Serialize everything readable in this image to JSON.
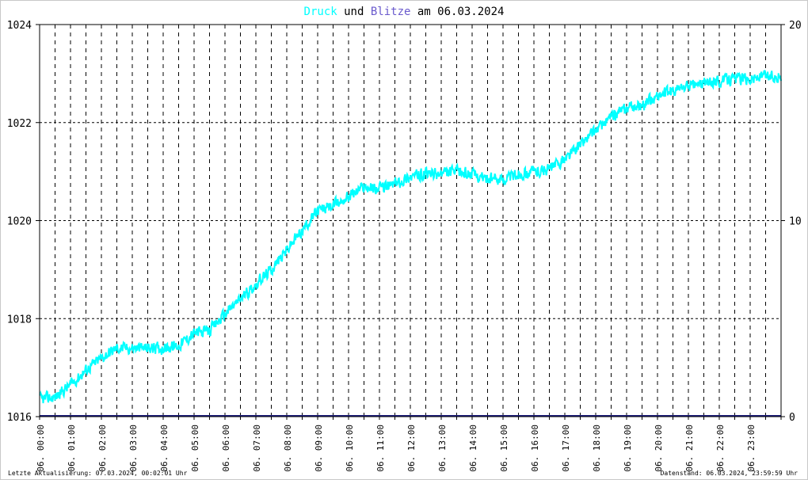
{
  "title": {
    "part1": "Druck",
    "part2": " und ",
    "part3": "Blitze",
    "part4": " am 06.03.2024"
  },
  "colors": {
    "pressure": "#00ffff",
    "lightning": "#6a5acd",
    "lightning_line": "#1a1a7a",
    "grid": "#000000",
    "axis": "#000000"
  },
  "footer": {
    "left": "Letzte Aktualisierung: 07.03.2024, 00:02:01 Uhr",
    "right": "Datenstand: 06.03.2024, 23:59:59 Uhr"
  },
  "chart_data": {
    "type": "line",
    "title": "Druck und Blitze am 06.03.2024",
    "grid": true,
    "y_left": {
      "range": [
        1016,
        1024
      ],
      "ticks": [
        "1016",
        "1018",
        "1020",
        "1022",
        "1024"
      ]
    },
    "y_right": {
      "range": [
        0,
        20
      ],
      "ticks": [
        "0",
        "10",
        "20"
      ]
    },
    "x_range_hours": [
      0,
      24
    ],
    "x_ticks": [
      "06. 00:00",
      "06. 01:00",
      "06. 02:00",
      "06. 03:00",
      "06. 04:00",
      "06. 05:00",
      "06. 06:00",
      "06. 07:00",
      "06. 08:00",
      "06. 09:00",
      "06. 10:00",
      "06. 11:00",
      "06. 12:00",
      "06. 13:00",
      "06. 14:00",
      "06. 15:00",
      "06. 16:00",
      "06. 17:00",
      "06. 18:00",
      "06. 19:00",
      "06. 20:00",
      "06. 21:00",
      "06. 22:00",
      "06. 23:00"
    ],
    "series": [
      {
        "name": "Druck",
        "axis": "left",
        "x": [
          0.0,
          0.5,
          1.0,
          1.5,
          2.0,
          2.5,
          3.0,
          3.5,
          4.0,
          4.5,
          5.0,
          5.5,
          6.0,
          6.5,
          7.0,
          7.5,
          8.0,
          8.5,
          9.0,
          9.5,
          10.0,
          10.5,
          11.0,
          11.5,
          12.0,
          12.5,
          13.0,
          13.5,
          14.0,
          14.5,
          15.0,
          15.5,
          16.0,
          16.5,
          17.0,
          17.5,
          18.0,
          18.5,
          19.0,
          19.5,
          20.0,
          20.5,
          21.0,
          21.5,
          22.0,
          22.5,
          23.0,
          23.5,
          24.0
        ],
        "values": [
          1016.35,
          1016.4,
          1016.65,
          1016.95,
          1017.2,
          1017.4,
          1017.4,
          1017.4,
          1017.4,
          1017.45,
          1017.7,
          1017.75,
          1018.1,
          1018.4,
          1018.7,
          1019.0,
          1019.4,
          1019.8,
          1020.2,
          1020.3,
          1020.5,
          1020.7,
          1020.65,
          1020.75,
          1020.9,
          1020.95,
          1020.95,
          1021.0,
          1020.95,
          1020.85,
          1020.85,
          1020.95,
          1021.0,
          1021.05,
          1021.25,
          1021.55,
          1021.85,
          1022.1,
          1022.3,
          1022.35,
          1022.55,
          1022.65,
          1022.75,
          1022.8,
          1022.85,
          1022.9,
          1022.9,
          1022.95,
          1022.95
        ]
      },
      {
        "name": "Blitze",
        "axis": "right",
        "x": [
          0,
          24
        ],
        "values": [
          0,
          0
        ]
      }
    ]
  }
}
